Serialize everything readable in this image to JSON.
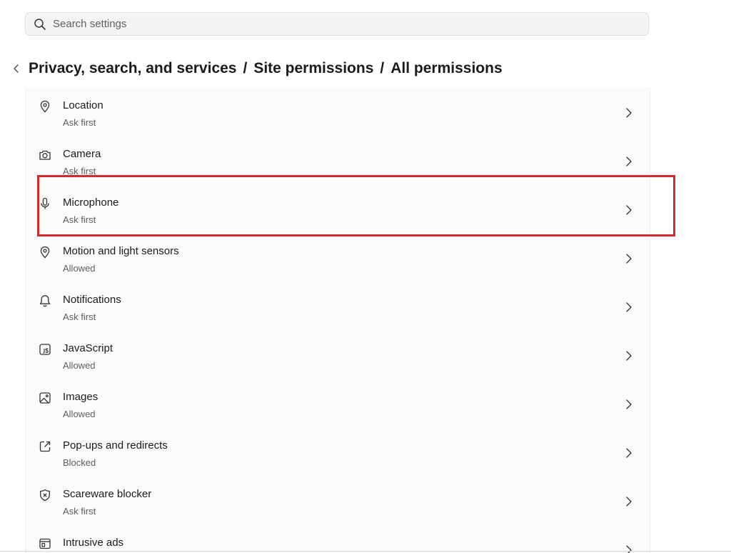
{
  "search": {
    "placeholder": "Search settings",
    "value": ""
  },
  "breadcrumb": {
    "items": [
      "Privacy, search, and services",
      "Site permissions",
      "All permissions"
    ],
    "separator": "/"
  },
  "permissions": [
    {
      "title": "Location",
      "status": "Ask first",
      "icon": "location-pin-icon"
    },
    {
      "title": "Camera",
      "status": "Ask first",
      "icon": "camera-icon"
    },
    {
      "title": "Microphone",
      "status": "Ask first",
      "icon": "microphone-icon"
    },
    {
      "title": "Motion and light sensors",
      "status": "Allowed",
      "icon": "location-pin-icon"
    },
    {
      "title": "Notifications",
      "status": "Ask first",
      "icon": "bell-icon"
    },
    {
      "title": "JavaScript",
      "status": "Allowed",
      "icon": "javascript-icon"
    },
    {
      "title": "Images",
      "status": "Allowed",
      "icon": "image-icon"
    },
    {
      "title": "Pop-ups and redirects",
      "status": "Blocked",
      "icon": "external-link-icon"
    },
    {
      "title": "Scareware blocker",
      "status": "Ask first",
      "icon": "shield-x-icon"
    },
    {
      "title": "Intrusive ads",
      "status": "",
      "icon": "ad-window-icon"
    }
  ],
  "highlight": {
    "target": "Microphone",
    "color": "#d42a32"
  },
  "colors": {
    "text_primary": "#1b1b1b",
    "text_secondary": "#5f5f5f",
    "card_background": "#fbfbfb"
  }
}
